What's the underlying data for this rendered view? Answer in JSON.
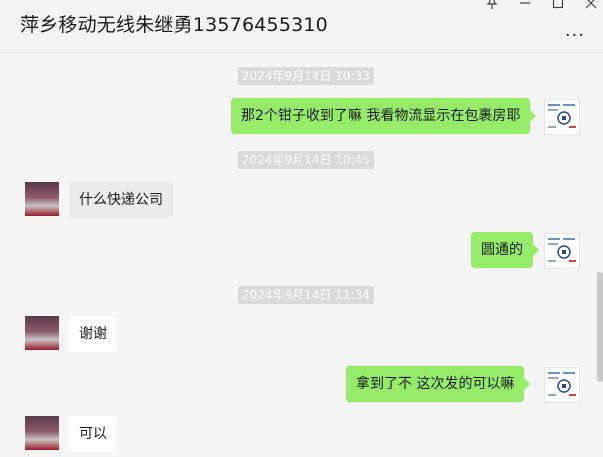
{
  "window": {
    "title": "萍乡移动无线朱继勇13576455310",
    "more_label": "..."
  },
  "messages": [
    {
      "type": "time",
      "text": "2024年9月14日 10:33"
    },
    {
      "type": "me",
      "text": "那2个钳子收到了嘛  我看物流显示在包裹房耶"
    },
    {
      "type": "time",
      "text": "2024年9月14日 10:45"
    },
    {
      "type": "them",
      "text": "什么快递公司"
    },
    {
      "type": "me",
      "text": "圆通的"
    },
    {
      "type": "time",
      "text": "2024年9月14日 11:34"
    },
    {
      "type": "them",
      "text": "谢谢"
    },
    {
      "type": "me",
      "text": "拿到了不    这次发的可以嘛"
    },
    {
      "type": "them",
      "text": "可以"
    }
  ]
}
